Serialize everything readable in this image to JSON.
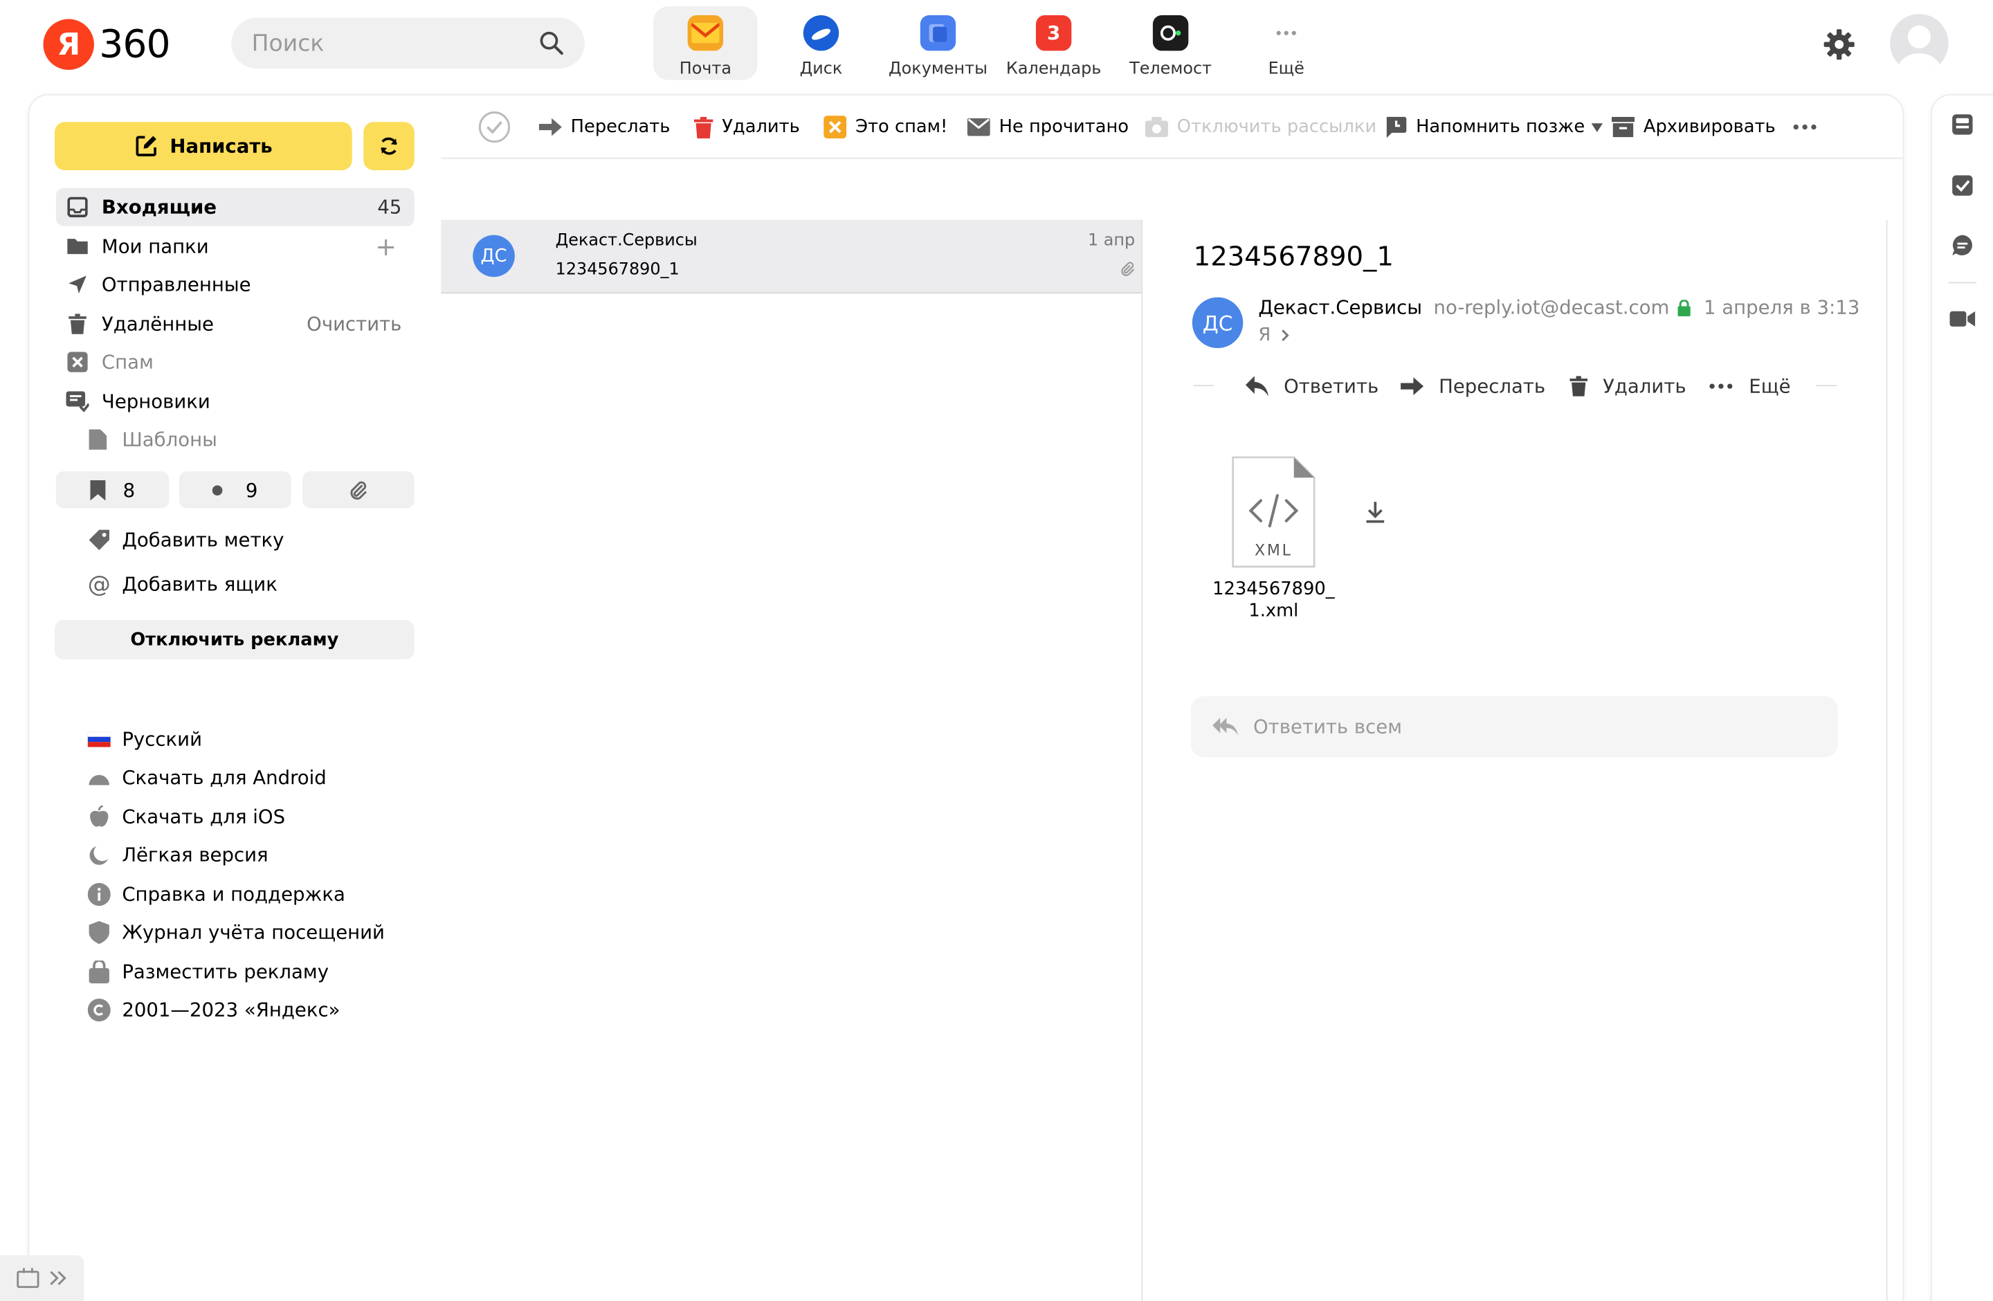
{
  "header": {
    "logo_letter": "Я",
    "logo_text": "360",
    "search_placeholder": "Поиск",
    "services": [
      {
        "label": "Почта",
        "color": "#f5a623",
        "icon": "mail-icon"
      },
      {
        "label": "Диск",
        "color": "#1a5fd6",
        "icon": "disk-icon"
      },
      {
        "label": "Документы",
        "color": "#4a7ff0",
        "icon": "documents-icon"
      },
      {
        "label": "Календарь",
        "color": "#f03a2e",
        "badge": "3",
        "icon": "calendar-icon"
      },
      {
        "label": "Телемост",
        "color": "#1c1c1c",
        "icon": "telemost-icon"
      },
      {
        "label": "Ещё",
        "icon": "more-icon"
      }
    ]
  },
  "sidebar": {
    "compose_label": "Написать",
    "folders": [
      {
        "label": "Входящие",
        "count": "45",
        "icon": "inbox-icon"
      },
      {
        "label": "Мои папки",
        "icon": "folder-icon"
      },
      {
        "label": "Отправленные",
        "icon": "sent-icon"
      },
      {
        "label": "Удалённые",
        "action": "Очистить",
        "icon": "trash-icon"
      },
      {
        "label": "Спам",
        "icon": "spam-icon"
      },
      {
        "label": "Черновики",
        "icon": "drafts-icon"
      },
      {
        "label": "Шаблоны",
        "icon": "template-icon"
      }
    ],
    "chips": {
      "bookmarks": "8",
      "unread": "9"
    },
    "add_label": "Добавить метку",
    "add_mailbox": "Добавить ящик",
    "disable_ads": "Отключить рекламу",
    "links": [
      {
        "label": "Русский",
        "icon": "flag-ru-icon"
      },
      {
        "label": "Скачать для Android",
        "icon": "android-icon"
      },
      {
        "label": "Скачать для iOS",
        "icon": "apple-icon"
      },
      {
        "label": "Лёгкая версия",
        "icon": "moon-icon"
      },
      {
        "label": "Справка и поддержка",
        "icon": "info-icon"
      },
      {
        "label": "Журнал учёта посещений",
        "icon": "shield-icon"
      },
      {
        "label": "Разместить рекламу",
        "icon": "bag-icon"
      },
      {
        "label": "2001—2023 «Яндекс»",
        "icon": "copyright-icon"
      }
    ]
  },
  "toolbar": {
    "forward": "Переслать",
    "delete": "Удалить",
    "spam": "Это спам!",
    "unread": "Не прочитано",
    "unsubscribe": "Отключить рассылки",
    "remind": "Напомнить позже",
    "archive": "Архивировать"
  },
  "message_list": [
    {
      "initials": "ДС",
      "sender": "Декаст.Сервисы",
      "subject": "1234567890_1",
      "date": "1 апр"
    }
  ],
  "message": {
    "subject": "1234567890_1",
    "initials": "ДС",
    "sender_name": "Декаст.Сервисы",
    "sender_email": "no-reply.iot@decast.com",
    "date": "1 апреля в 3:13",
    "recipient": "Я",
    "actions": {
      "reply": "Ответить",
      "forward": "Переслать",
      "delete": "Удалить",
      "more": "Ещё"
    },
    "attachment": {
      "type": "XML",
      "name_line1": "1234567890_",
      "name_line2": "1.xml"
    },
    "reply_all": "Ответить всем"
  },
  "colors": {
    "accent": "#fcdd5a",
    "avatar": "#4a86e8",
    "logo": "#fc3f1d"
  }
}
